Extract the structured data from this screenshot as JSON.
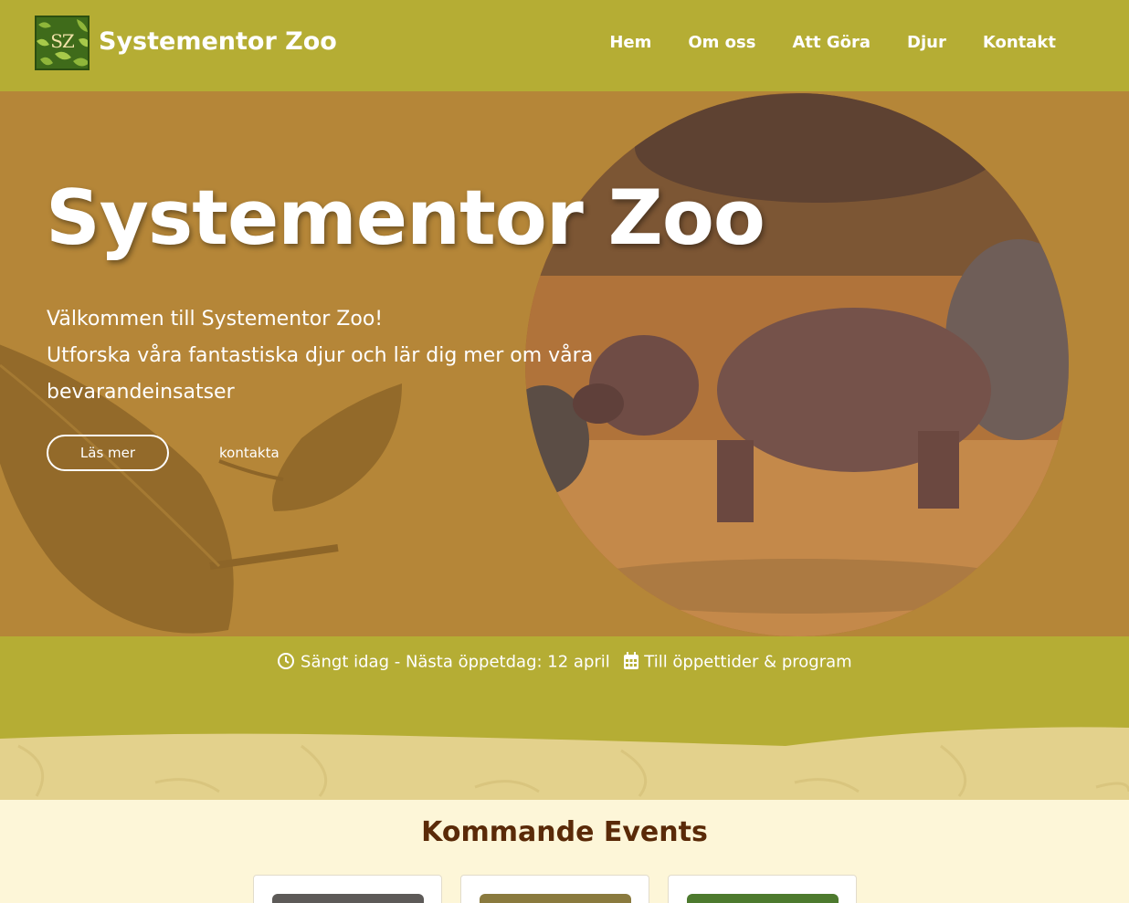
{
  "header": {
    "logo_text": "SZ",
    "brand": "Systementor Zoo",
    "nav": [
      "Hem",
      "Om oss",
      "Att Göra",
      "Djur",
      "Kontakt"
    ]
  },
  "hero": {
    "title": "Systementor Zoo",
    "subtitle_line1": "Välkommen till Systementor Zoo!",
    "subtitle_line2": "Utforska våra fantastiska djur och lär dig mer om våra bevarandeinsatser",
    "primary_button": "Läs mer",
    "secondary_link": "kontakta"
  },
  "status": {
    "icon_clock": "clock-icon",
    "closed_text": "Sängt idag - Nästa öppetdag: 12 april",
    "icon_calendar": "calendar-icon",
    "program_link": "Till öppettider & program"
  },
  "events": {
    "title": "Kommande Events"
  },
  "colors": {
    "header_bg": "#b5ad34",
    "hero_bg": "#b58638",
    "band_light": "#e3d18c",
    "section_bg": "#fdf6d8",
    "heading_brown": "#5a2a08"
  }
}
